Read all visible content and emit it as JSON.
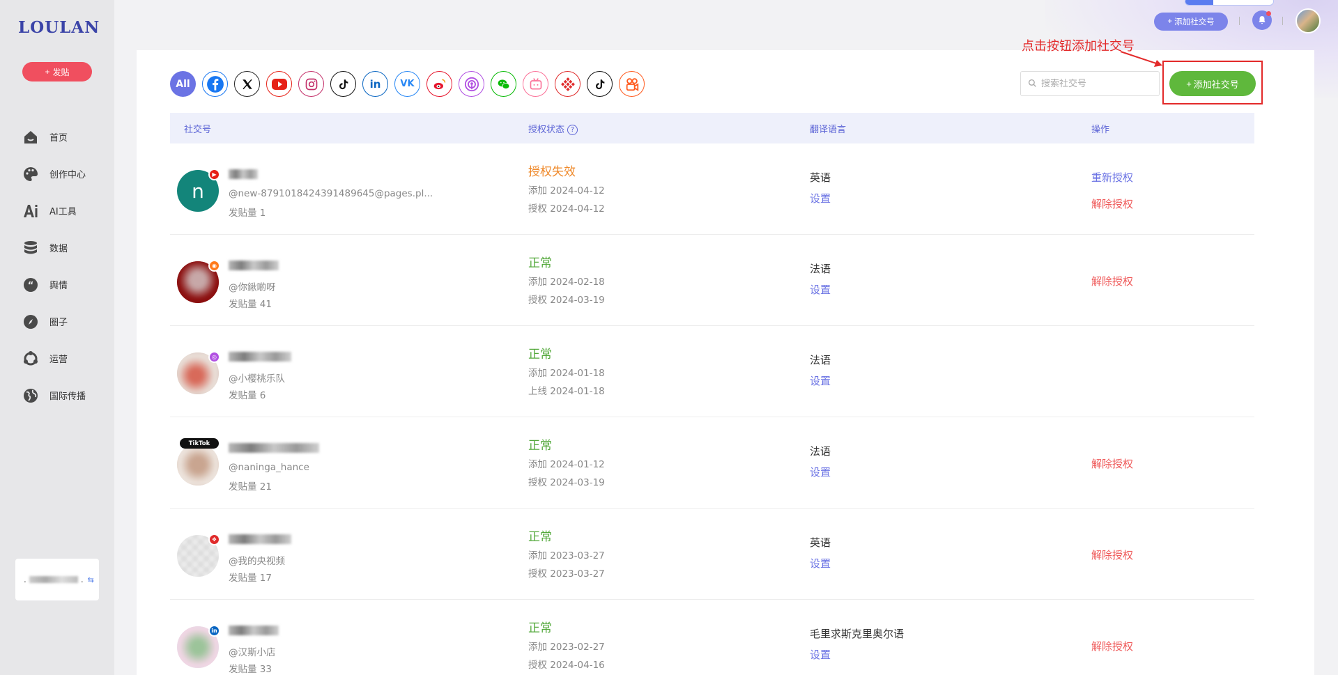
{
  "sidebar": {
    "logo": "LOULAN",
    "post_button": "发贴",
    "items": [
      {
        "label": "首页",
        "icon": "home-icon"
      },
      {
        "label": "创作中心",
        "icon": "palette-icon"
      },
      {
        "label": "AI工具",
        "icon": "ai-icon"
      },
      {
        "label": "数据",
        "icon": "database-icon"
      },
      {
        "label": "舆情",
        "icon": "quote-icon"
      },
      {
        "label": "圈子",
        "icon": "compass-icon"
      },
      {
        "label": "运营",
        "icon": "operation-icon"
      },
      {
        "label": "国际传播",
        "icon": "globe-icon"
      }
    ],
    "user_card_suffix": "."
  },
  "topbar": {
    "add_account": "添加社交号"
  },
  "filters": {
    "all_label": "All",
    "platforms": [
      "facebook",
      "x",
      "youtube",
      "instagram",
      "tiktok",
      "linkedin",
      "vk",
      "weibo",
      "podcast",
      "wechat",
      "bilibili",
      "kuaishou-grid",
      "douyin",
      "kuaishou"
    ]
  },
  "search": {
    "placeholder": "搜索社交号"
  },
  "add_button": "添加社交号",
  "annotation": "点击按钮添加社交号",
  "table": {
    "headers": {
      "account": "社交号",
      "auth": "授权状态",
      "lang": "翻译语言",
      "ops": "操作"
    },
    "rows": [
      {
        "avatar_letter": "n",
        "avatar_color": "#13857a",
        "badge": "youtube",
        "handle": "@new-8791018424391489645@pages.pl...",
        "posts": "发贴量 1",
        "status": "授权失效",
        "status_type": "fail",
        "date1": "添加 2024-04-12",
        "date2": "授权 2024-04-12",
        "lang": "英语",
        "setting": "设置",
        "reauth": "重新授权",
        "unauth": "解除授权"
      },
      {
        "avatar_letter": "",
        "avatar_color": "#8b0f0f",
        "badge": "weibo",
        "handle": "@你鍬啲呀",
        "posts": "发贴量 41",
        "status": "正常",
        "status_type": "ok",
        "date1": "添加 2024-02-18",
        "date2": "授权 2024-03-19",
        "lang": "法语",
        "setting": "设置",
        "reauth": "",
        "unauth": "解除授权"
      },
      {
        "avatar_letter": "",
        "avatar_color": "#d9c7bf",
        "badge": "podcast",
        "handle": "@小樱桃乐队",
        "posts": "发贴量 6",
        "status": "正常",
        "status_type": "ok",
        "date1": "添加 2024-01-18",
        "date2": "上线 2024-01-18",
        "lang": "法语",
        "setting": "设置",
        "reauth": "",
        "unauth": ""
      },
      {
        "avatar_letter": "",
        "avatar_color": "#e0cfc4",
        "badge": "TikTok",
        "handle": "@naninga_hance",
        "posts": "发贴量 21",
        "status": "正常",
        "status_type": "ok",
        "date1": "添加 2024-01-12",
        "date2": "授权 2024-03-19",
        "lang": "法语",
        "setting": "设置",
        "reauth": "",
        "unauth": "解除授权"
      },
      {
        "avatar_letter": "",
        "avatar_color": "#e8e8e8",
        "badge": "kuaishou-grid",
        "handle": "@我的央视频",
        "posts": "发贴量 17",
        "status": "正常",
        "status_type": "ok",
        "date1": "添加 2023-03-27",
        "date2": "授权 2023-03-27",
        "lang": "英语",
        "setting": "设置",
        "reauth": "",
        "unauth": "解除授权"
      },
      {
        "avatar_letter": "",
        "avatar_color": "#e6dbe6",
        "badge": "linkedin",
        "handle": "@汉斯小店",
        "posts": "发贴量 33",
        "status": "正常",
        "status_type": "ok",
        "date1": "添加 2023-02-27",
        "date2": "授权 2024-04-16",
        "lang": "毛里求斯克里奥尔语",
        "setting": "设置",
        "reauth": "",
        "unauth": "解除授权"
      }
    ]
  },
  "colors": {
    "accent": "#6b73e4",
    "success": "#52a83a",
    "warning": "#ef8a2c",
    "danger": "#ef5a5a",
    "add_green": "#5fb83c",
    "annotation_red": "#e32a2a"
  }
}
